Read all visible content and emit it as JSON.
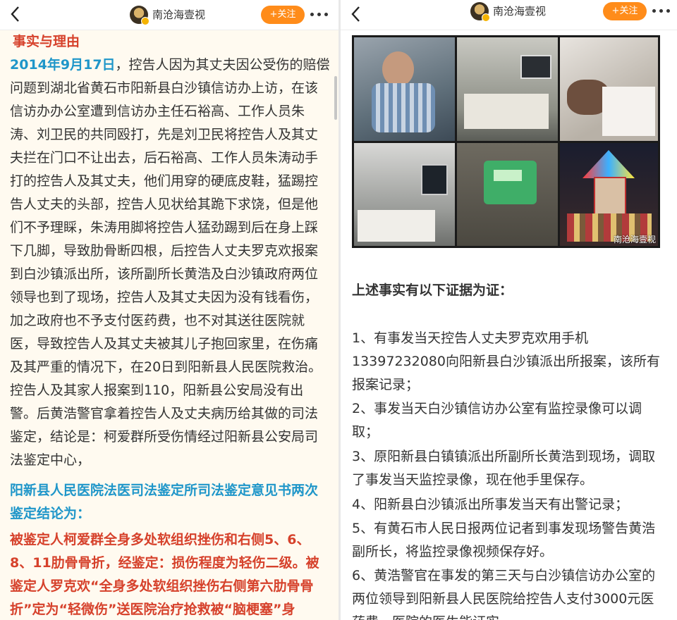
{
  "account": {
    "name": "南沧海壹视",
    "follow_label": "+关注",
    "back_icon": "chevron-left-icon",
    "more_icon": "more-dots-icon"
  },
  "left": {
    "heading": "事实与理由",
    "date": "2014年9月17日",
    "lines": [
      "，控告人因为其丈夫因公受伤的赔偿",
      "问题到湖北省黄石市阳新县白沙镇信访办上访，在该",
      "信访办办公室遭到信访办主任石裕高、工作人员朱",
      "涛、刘卫民的共同殴打，先是刘卫民将控告人及其丈",
      "夫拦在门口不让出去，后石裕高、工作人员朱涛动手",
      "打的控告人及其丈夫，他们用穿的硬底皮鞋，猛踢控",
      "告人丈夫的头部，控告人见状给其跪下求饶，但是他",
      "们不予理睬，朱涛用脚将控告人猛劲踢到后在身上踩",
      "下几脚，导致肋骨断四根，后控告人丈夫罗克欢报案",
      "到白沙镇派出所，该所副所长黄浩及白沙镇政府两位",
      "领导也到了现场，控告人及其丈夫因为没有钱看伤，",
      "加之政府也不予支付医药费，也不对其送往医院就",
      "医，导致控告人及其丈夫被其儿子抱回家里，在伤痛",
      "及其严重的情况下，在20日到阳新县人民医院救治。",
      "控告人及其家人报案到110，阳新县公安局没有出",
      "警。后黄浩警官拿着控告人及丈夫病历给其做的司法",
      "鉴定，结论是：柯爱群所受伤情经过阳新县公安局司",
      "法鉴定中心，"
    ],
    "blue_lines": [
      "阳新县人民医院法医司法鉴定所司法鉴定意见书两次",
      "鉴定结论为："
    ],
    "red_lines": [
      "被鉴定人柯爱群全身多处软组织挫伤和右侧5、6、",
      "8、11肋骨骨折，经鉴定：损伤程度为轻伤二级。被",
      "鉴定人罗克欢“全身多处软组织挫伤右侧第六肋骨骨",
      "折”定为“轻微伤”送医院治疗抢救被“脑梗塞”身"
    ]
  },
  "right": {
    "watermark": "南沧海壹视",
    "evidence_heading": "上述事实有以下证据为证：",
    "lines": [
      "1、有事发当天控告人丈夫罗克欢用手机",
      "13397232080向阳新县白沙镇派出所报案，该所有",
      "报案记录；",
      "2、事发当天白沙镇信访办公室有监控录像可以调",
      "取；",
      "3、原阳新县白镇镇派出所副所长黄浩到现场，调取",
      "了事发当天监控录像，现在他手里保存。",
      "4、阳新县白沙镇派出所事发当天有出警记录；",
      "5、有黄石市人民日报两位记者到事发现场警告黄浩",
      "副所长，将监控录像视频保存好。",
      "6、黄浩警官在事发的第三天与白沙镇信访办公室的",
      "两位领导到阳新县人民医院给控告人支付3000元医",
      "药费，医院的医生能证实"
    ]
  }
}
